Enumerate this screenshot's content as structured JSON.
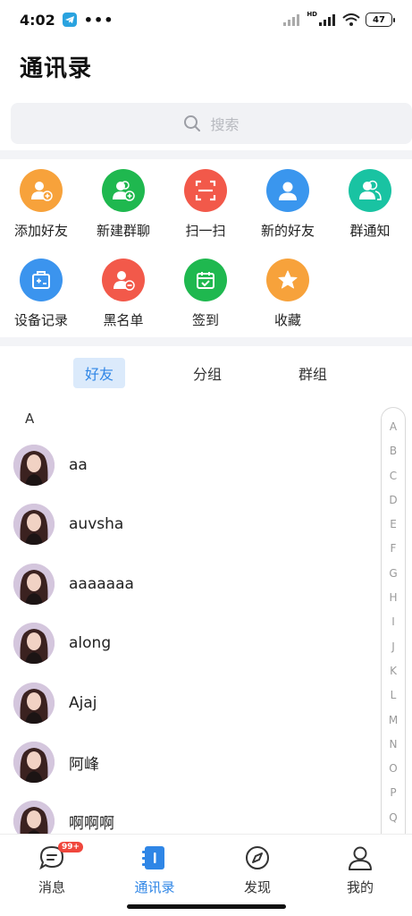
{
  "status_bar": {
    "time": "4:02",
    "dots": "•••",
    "battery": "47",
    "hd": "HD"
  },
  "header": {
    "title": "通讯录"
  },
  "search": {
    "placeholder": "搜索"
  },
  "shortcuts": [
    {
      "label": "添加好友",
      "icon": "add-friend-icon",
      "color": "#f7a23b"
    },
    {
      "label": "新建群聊",
      "icon": "new-group-icon",
      "color": "#1fb84f"
    },
    {
      "label": "扫一扫",
      "icon": "scan-icon",
      "color": "#f2594a"
    },
    {
      "label": "新的好友",
      "icon": "new-friend-icon",
      "color": "#3a96ee"
    },
    {
      "label": "群通知",
      "icon": "group-notice-icon",
      "color": "#19c3a2"
    },
    {
      "label": "设备记录",
      "icon": "device-record-icon",
      "color": "#3b94ee"
    },
    {
      "label": "黑名单",
      "icon": "blacklist-icon",
      "color": "#f2594a"
    },
    {
      "label": "签到",
      "icon": "checkin-icon",
      "color": "#1fb84f"
    },
    {
      "label": "收藏",
      "icon": "favorites-icon",
      "color": "#f7a23b"
    }
  ],
  "tabs": [
    {
      "label": "好友",
      "active": true
    },
    {
      "label": "分组",
      "active": false
    },
    {
      "label": "群组",
      "active": false
    }
  ],
  "section_letter": "A",
  "contacts": [
    {
      "name": "aa"
    },
    {
      "name": "auvsha"
    },
    {
      "name": "aaaaaaa"
    },
    {
      "name": "along"
    },
    {
      "name": "Ajaj"
    },
    {
      "name": "阿峰"
    },
    {
      "name": "啊啊啊"
    }
  ],
  "index_letters": [
    "A",
    "B",
    "C",
    "D",
    "E",
    "F",
    "G",
    "H",
    "I",
    "J",
    "K",
    "L",
    "M",
    "N",
    "O",
    "P",
    "Q"
  ],
  "bottom_nav": [
    {
      "label": "消息",
      "icon": "message-icon",
      "badge": "99+"
    },
    {
      "label": "通讯录",
      "icon": "contacts-icon",
      "active": true
    },
    {
      "label": "发现",
      "icon": "compass-icon"
    },
    {
      "label": "我的",
      "icon": "profile-icon"
    }
  ],
  "colors": {
    "accent": "#2f86e6",
    "badge": "#f0463c"
  }
}
